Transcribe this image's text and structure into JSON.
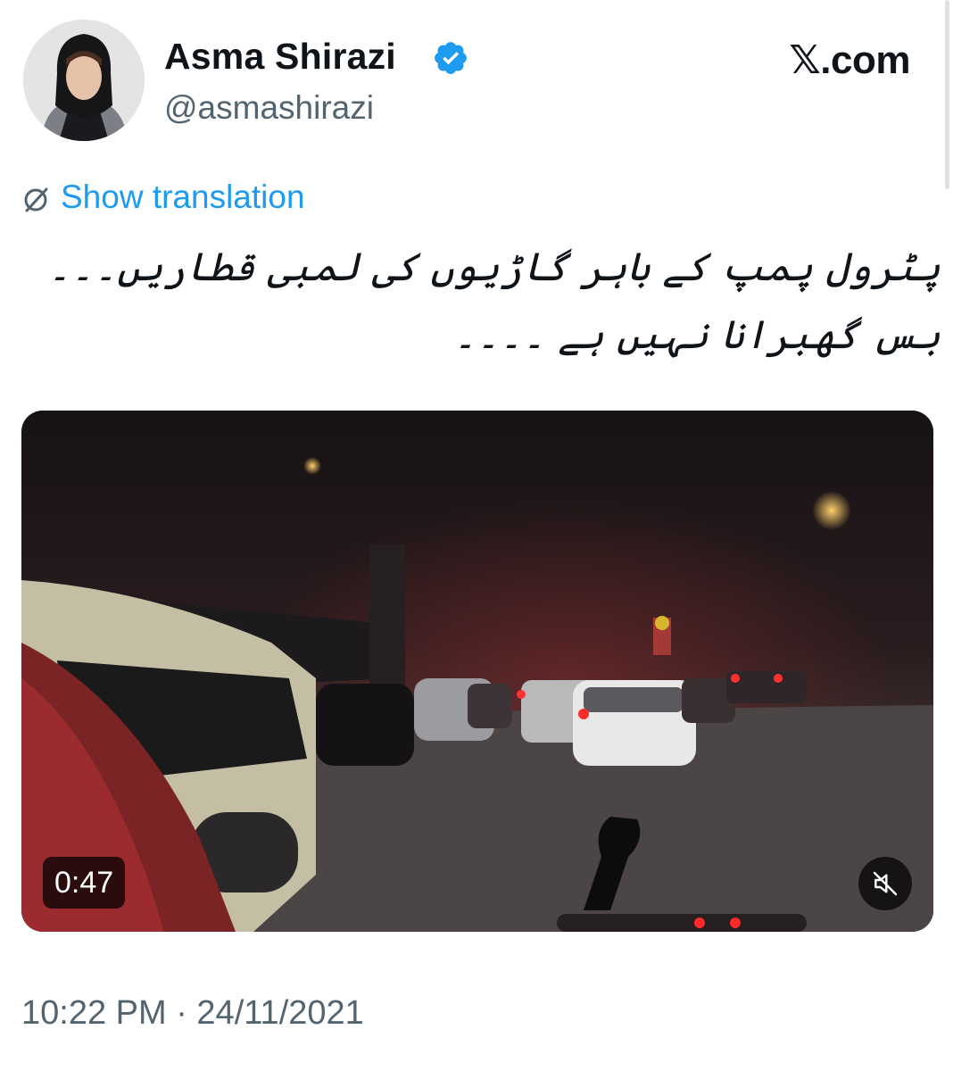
{
  "tweet": {
    "author": {
      "display_name": "Asma Shirazi",
      "handle": "@asmashirazi",
      "verified": true,
      "avatar_icon": "profile-photo"
    },
    "brand": "𝕏.com",
    "show_translation": "Show translation",
    "text": "پٹرول پمپ کے باہر گاڑیوں کی لمبی قطاریں۔۔۔ بس گھبرانا نہیں ہے ۔۔۔۔",
    "media": {
      "type": "video",
      "duration": "0:47",
      "mute_icon": "speaker-muted-icon"
    },
    "timestamp": "10:22 PM · 24/11/2021"
  },
  "colors": {
    "link": "#1d9bf0",
    "secondary_text": "#536471",
    "verified_badge": "#1d9bf0"
  }
}
